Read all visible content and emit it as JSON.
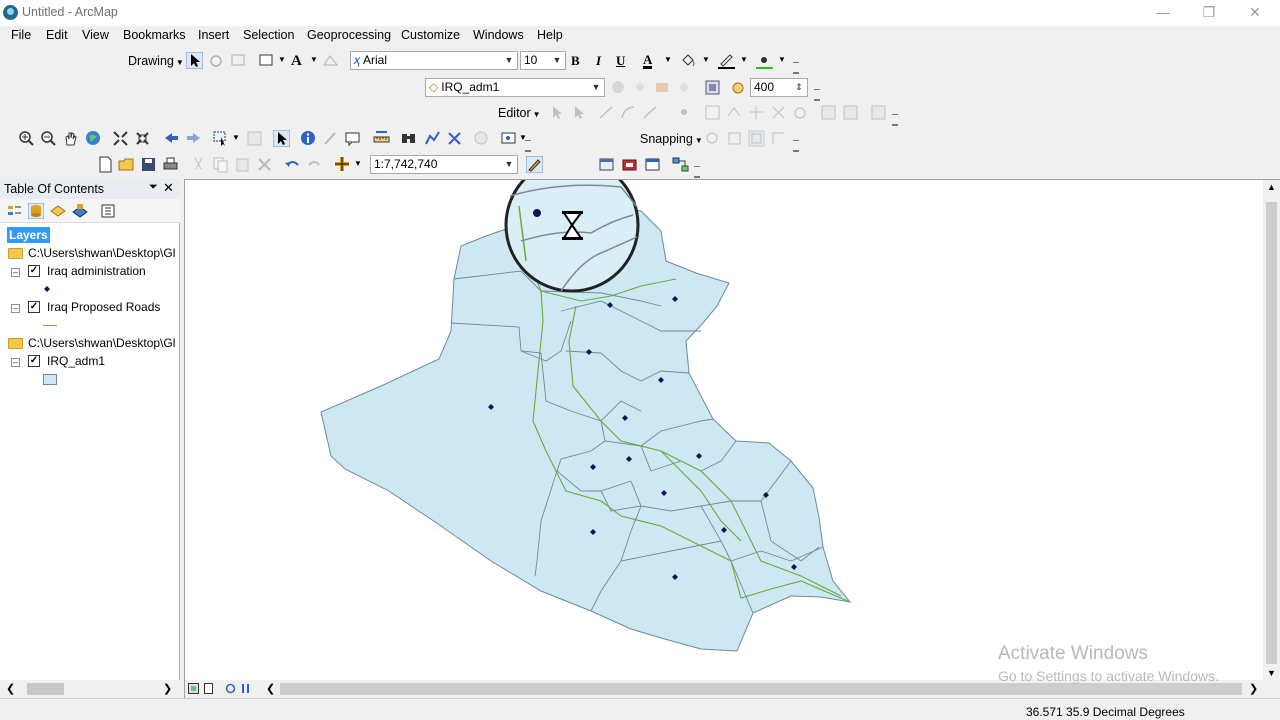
{
  "window": {
    "title": "Untitled - ArcMap"
  },
  "menu": [
    "File",
    "Edit",
    "View",
    "Bookmarks",
    "Insert",
    "Selection",
    "Geoprocessing",
    "Customize",
    "Windows",
    "Help"
  ],
  "drawing_toolbar": {
    "drawing_label": "Drawing",
    "font_name": "Arial",
    "font_size": "10",
    "bold": "B",
    "italic": "I",
    "underline": "U",
    "font_color_icon": "A"
  },
  "effects_toolbar": {
    "layer": "IRQ_adm1",
    "value": "400"
  },
  "editor_toolbar": {
    "editor_label": "Editor"
  },
  "snapping_toolbar": {
    "snapping_label": "Snapping"
  },
  "standard_toolbar": {
    "scale": "1:7,742,740"
  },
  "toc": {
    "title": "Table Of Contents",
    "root": "Layers",
    "groups": [
      {
        "path": "C:\\Users\\shwan\\Desktop\\Gl",
        "layers": [
          "Iraq administration",
          "Iraq Proposed Roads"
        ]
      },
      {
        "path": "C:\\Users\\shwan\\Desktop\\Gl",
        "layers": [
          "IRQ_adm1"
        ]
      }
    ]
  },
  "map": {
    "fill_color": "#cde8f2",
    "road_color": "#6aaa3a",
    "point_color": "#15125a"
  },
  "status": {
    "coords": "36.571  35.9 Decimal Degrees"
  },
  "watermark": {
    "line1": "Activate Windows",
    "line2": "Go to Settings to activate Windows."
  }
}
